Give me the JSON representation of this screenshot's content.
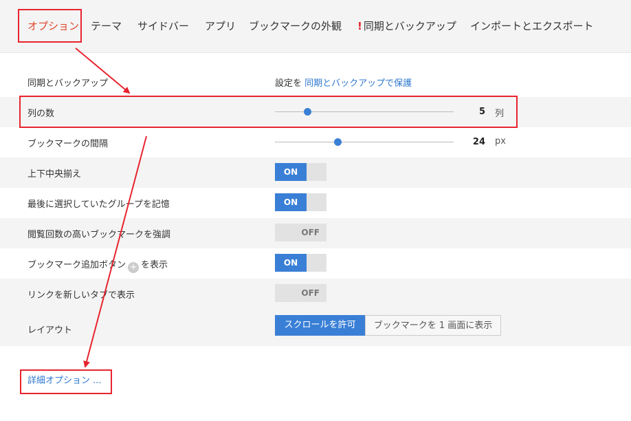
{
  "nav": {
    "tabs": [
      {
        "label": "オプション"
      },
      {
        "label": "テーマ"
      },
      {
        "label": "サイドバー"
      },
      {
        "label": "アプリ"
      },
      {
        "label": "ブックマークの外観"
      },
      {
        "label": "同期とバックアップ",
        "warning": "!"
      },
      {
        "label": "インポートとエクスポート"
      }
    ],
    "active_tab": "オプション"
  },
  "settings": {
    "sync": {
      "label": "同期とバックアップ",
      "prefix": "設定を",
      "link": "同期とバックアップで保護"
    },
    "columns": {
      "label": "列の数",
      "value": "5",
      "unit": "列",
      "level": 0.18
    },
    "spacing": {
      "label": "ブックマークの間隔",
      "value": "24",
      "unit": "px",
      "level": 0.35
    },
    "center_align": {
      "label": "上下中央揃え",
      "state": "ON"
    },
    "remember_group": {
      "label": "最後に選択していたグループを記憶",
      "state": "ON"
    },
    "highlight_frequent": {
      "label": "閲覧回数の高いブックマークを強調",
      "state": "OFF"
    },
    "add_button": {
      "label_before": "ブックマーク追加ボタン",
      "icon": "+",
      "label_after": "を表示",
      "state": "ON"
    },
    "new_tab": {
      "label": "リンクを新しいタブで表示",
      "state": "OFF"
    },
    "layout": {
      "label": "レイアウト",
      "options": [
        "スクロールを許可",
        "ブックマークを 1 画面に表示"
      ],
      "selected": "スクロールを許可"
    }
  },
  "advanced": {
    "label": "詳細オプション ..."
  },
  "colors": {
    "accent": "#3a7fd6",
    "active_tab": "#e0452b",
    "annotation": "#e8232e",
    "link": "#2f78d0"
  }
}
